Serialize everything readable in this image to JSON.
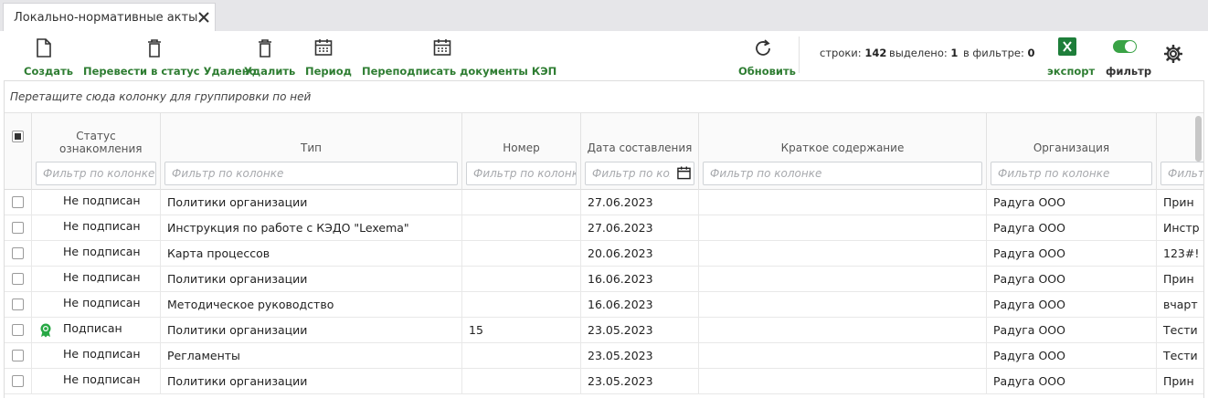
{
  "tab": {
    "title": "Локально-нормативные акты"
  },
  "toolbar": {
    "create": "Создать",
    "status_deleted": "Перевести в статус Удалено",
    "delete": "Удалить",
    "period": "Период",
    "resign": "Переподписать документы КЭП",
    "refresh": "Обновить",
    "export": "экспорт",
    "filter": "фильтр",
    "filter_enabled": true
  },
  "counts": {
    "rows_label": "строки:",
    "rows_value": "142",
    "selected_label": "выделено:",
    "selected_value": "1",
    "infilter_label": "в фильтре:",
    "infilter_value": "0"
  },
  "grid": {
    "group_hint": "Перетащите сюда колонку для группировки по ней",
    "columns": [
      {
        "title": "Статус ознакомления",
        "placeholder": "Фильтр по колонке"
      },
      {
        "title": "Тип",
        "placeholder": "Фильтр по колонке"
      },
      {
        "title": "Номер",
        "placeholder": "Фильтр по колонке"
      },
      {
        "title": "Дата составления",
        "placeholder": "Фильтр по колонке"
      },
      {
        "title": "Краткое содержание",
        "placeholder": "Фильтр по колонке"
      },
      {
        "title": "Организация",
        "placeholder": "Фильтр по колонке"
      },
      {
        "title": "",
        "placeholder": "Фильтр по колонке"
      }
    ],
    "rows": [
      {
        "status": "Не подписан",
        "signed": false,
        "type": "Политики организации",
        "number": "",
        "date": "27.06.2023",
        "summary": "",
        "org": "Радуга ООО",
        "extra": "Прин"
      },
      {
        "status": "Не подписан",
        "signed": false,
        "type": "Инструкция по работе с КЭДО \"Lexema\"",
        "number": "",
        "date": "27.06.2023",
        "summary": "",
        "org": "Радуга ООО",
        "extra": "Инстр"
      },
      {
        "status": "Не подписан",
        "signed": false,
        "type": "Карта процессов",
        "number": "",
        "date": "20.06.2023",
        "summary": "",
        "org": "Радуга ООО",
        "extra": "123#!"
      },
      {
        "status": "Не подписан",
        "signed": false,
        "type": "Политики организации",
        "number": "",
        "date": "16.06.2023",
        "summary": "",
        "org": "Радуга ООО",
        "extra": "Прин"
      },
      {
        "status": "Не подписан",
        "signed": false,
        "type": "Методическое руководство",
        "number": "",
        "date": "16.06.2023",
        "summary": "",
        "org": "Радуга ООО",
        "extra": "вчарт"
      },
      {
        "status": "Подписан",
        "signed": true,
        "type": "Политики организации",
        "number": "15",
        "date": "23.05.2023",
        "summary": "",
        "org": "Радуга ООО",
        "extra": "Тести"
      },
      {
        "status": "Не подписан",
        "signed": false,
        "type": "Регламенты",
        "number": "",
        "date": "23.05.2023",
        "summary": "",
        "org": "Радуга ООО",
        "extra": "Тести"
      },
      {
        "status": "Не подписан",
        "signed": false,
        "type": "Политики организации",
        "number": "",
        "date": "23.05.2023",
        "summary": "",
        "org": "Радуга ООО",
        "extra": "Прин"
      }
    ]
  },
  "colors": {
    "accent": "#2e7d32",
    "toggle_on": "#3aa346",
    "excel": "#1e7e3a"
  }
}
